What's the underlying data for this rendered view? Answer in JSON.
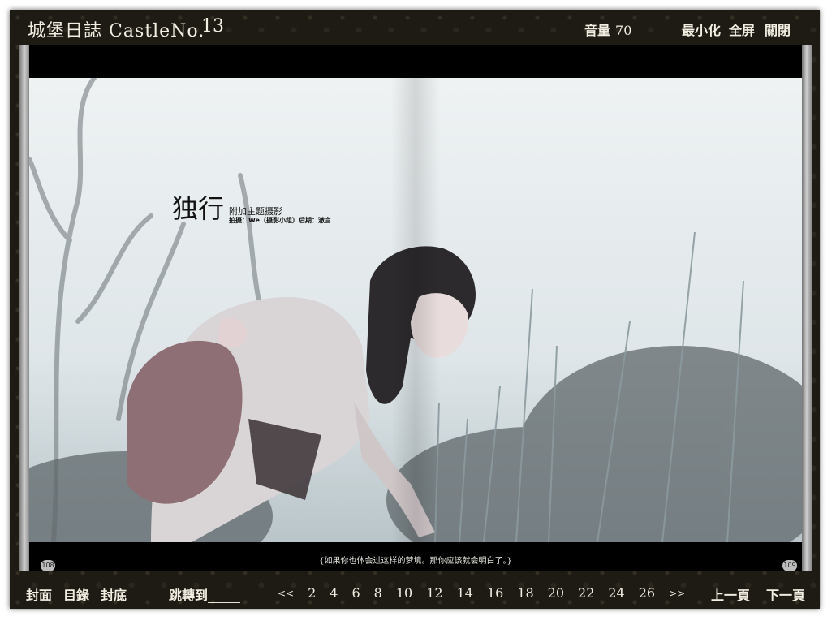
{
  "header": {
    "app_title": "城堡日誌 CastleNo.",
    "issue_number": "13",
    "volume_label": "音量",
    "volume_value": "70",
    "minimize": "最小化",
    "fullscreen": "全屏",
    "close": "關閉"
  },
  "page": {
    "title": "独行",
    "subtitle": "附加主题摄影",
    "credit": "拍摄：We（摄影小组）后期：澈言",
    "caption": "{如果你也体会过这样的梦境。那你应该就会明白了。}",
    "left_page": "108",
    "right_page": "109"
  },
  "footer": {
    "cover": "封面",
    "contents": "目錄",
    "back_cover": "封底",
    "jump_label": "跳轉到",
    "jump_value": "",
    "prev_arrow": "<<",
    "next_arrow": ">>",
    "pages": [
      "2",
      "4",
      "6",
      "8",
      "10",
      "12",
      "14",
      "16",
      "18",
      "20",
      "22",
      "24",
      "26"
    ],
    "prev_page": "上一頁",
    "next_page": "下一頁"
  }
}
